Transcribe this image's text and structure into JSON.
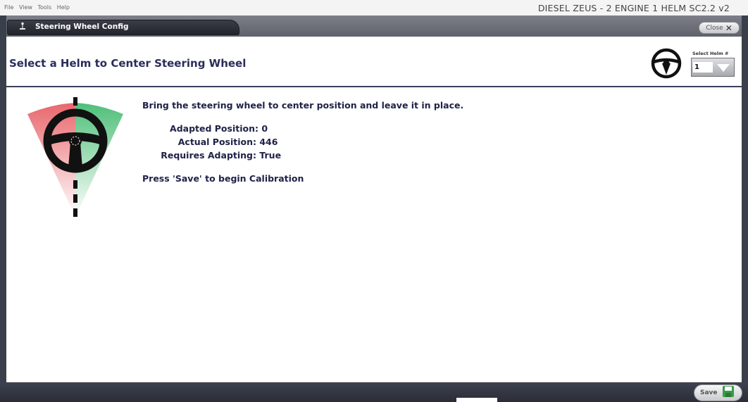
{
  "menu": {
    "items": [
      "File",
      "View",
      "Tools",
      "Help"
    ]
  },
  "app_title": "DIESEL ZEUS - 2 ENGINE 1 HELM SC2.2 v2",
  "window": {
    "tab_label": "Steering Wheel Config",
    "tab_icon": "joystick-icon",
    "close_label": "Close"
  },
  "header": {
    "title": "Select a Helm to Center Steering Wheel",
    "helm_icon": "steering-wheel-icon",
    "select_label": "Select Helm #",
    "select_value": "1"
  },
  "main": {
    "instruction": "Bring the steering wheel to center position and leave it in place.",
    "info": [
      {
        "label": "Adapted Position:",
        "value": "0"
      },
      {
        "label": "Actual Position:",
        "value": "446"
      },
      {
        "label": "Requires Adapting:",
        "value": "True"
      }
    ],
    "press_save": "Press 'Save' to begin Calibration"
  },
  "footer": {
    "save_label": "Save",
    "save_icon": "floppy-disk-icon"
  },
  "colors": {
    "frame": "#3a3f4c",
    "text_primary": "#1e2147",
    "turn_left": "#e8676d",
    "turn_right": "#4fbf79",
    "save_icon": "#3a9a4a"
  }
}
